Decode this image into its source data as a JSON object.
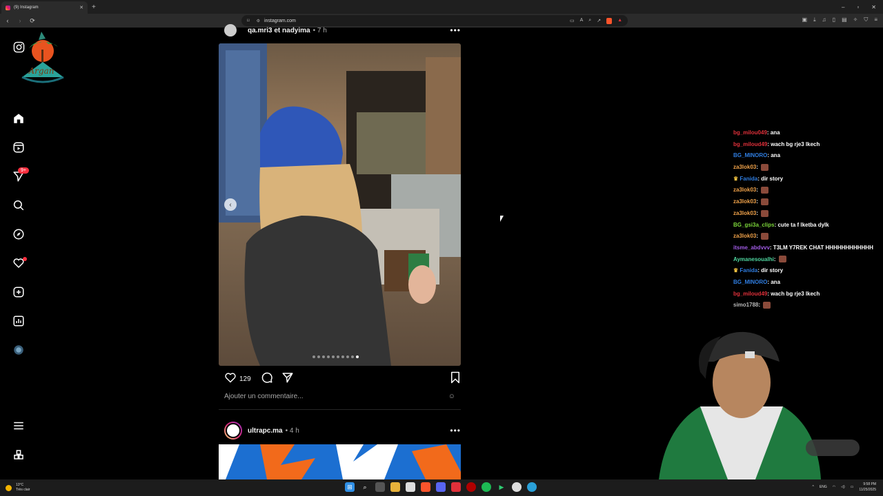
{
  "browser": {
    "tab_title": "(9) Instagram",
    "new_tab": "+",
    "url": "instagram.com",
    "window_controls": [
      "–",
      "▫",
      "✕"
    ]
  },
  "sidebar": {
    "notifications_badge": "9+",
    "logo_text": "Argan",
    "items": [
      "instagram-logo",
      "home",
      "reels",
      "messages",
      "search",
      "explore",
      "notifications",
      "create",
      "dashboard",
      "profile",
      "more",
      "also-from-meta"
    ]
  },
  "post1": {
    "username": "qa.mri3 et nadyima",
    "time": "• 7 h",
    "likes": "129",
    "comment_placeholder": "Ajouter un commentaire...",
    "carousel_count": 10,
    "carousel_active": 10
  },
  "post2": {
    "username": "ultrapc.ma",
    "time": "• 4 h"
  },
  "chat": [
    {
      "user": "bg_milou049",
      "color": "#e0303a",
      "text": ": ana"
    },
    {
      "user": "bg_miloud49",
      "color": "#e0303a",
      "text": ": wach bg rje3 lkech"
    },
    {
      "user": "BG_MINORO",
      "color": "#2f7de0",
      "text": ": ana"
    },
    {
      "user": "za3lok03",
      "color": "#f0a24a",
      "text": ":",
      "emote": true
    },
    {
      "user": "Fanida",
      "color": "#2f7de0",
      "text": ": dir story",
      "crown": true
    },
    {
      "user": "za3lok03",
      "color": "#f0a24a",
      "text": ":",
      "emote": true
    },
    {
      "user": "za3lok03",
      "color": "#f0a24a",
      "text": ":",
      "emote": true
    },
    {
      "user": "za3lok03",
      "color": "#f0a24a",
      "text": ":",
      "emote": true
    },
    {
      "user": "BG_gsi3a_clips",
      "color": "#7cd63a",
      "text": ": cute ta f lketba dylk"
    },
    {
      "user": "za3lok03",
      "color": "#f0a24a",
      "text": ":",
      "emote": true
    },
    {
      "user": "itsme_abdvvv",
      "color": "#a25ce6",
      "text": ": T3LM Y7REK CHAT HHHHHHHHHHHH"
    },
    {
      "user": "Aymanesoualhi",
      "color": "#4fd6a0",
      "text": ":",
      "emote": true
    },
    {
      "user": "Fanida",
      "color": "#2f7de0",
      "text": ": dir story",
      "crown": true
    },
    {
      "user": "BG_MINORO",
      "color": "#2f7de0",
      "text": ": ana"
    },
    {
      "user": "bg_miloud49",
      "color": "#e0303a",
      "text": ": wach bg rje3 lkech"
    },
    {
      "user": "simo1788",
      "color": "#b8b8b8",
      "text": ":",
      "emote": true
    }
  ],
  "taskbar": {
    "weather_temp": "13°C",
    "weather_desc": "Très clair",
    "lang": "ENG",
    "time": "9:58 PM",
    "date": "11/25/2025"
  },
  "colors": {
    "background": "#000000",
    "badge": "#ff3040",
    "secondary_text": "#a8a8a8"
  }
}
